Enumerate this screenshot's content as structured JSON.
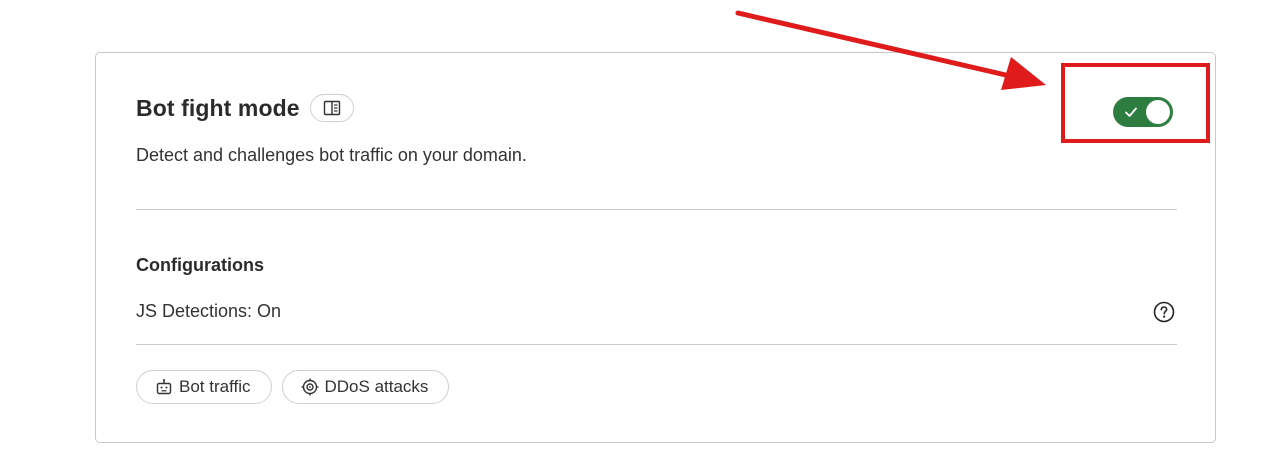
{
  "header": {
    "title": "Bot fight mode",
    "description": "Detect and challenges bot traffic on your domain."
  },
  "toggle": {
    "state": "on",
    "color": "#2c7d3f"
  },
  "configurations": {
    "title": "Configurations",
    "js_detections": "JS Detections: On"
  },
  "tags": [
    {
      "label": "Bot traffic",
      "icon": "robot-icon"
    },
    {
      "label": "DDoS attacks",
      "icon": "crosshair-icon"
    }
  ],
  "annotation": {
    "color": "#e01b1b"
  }
}
